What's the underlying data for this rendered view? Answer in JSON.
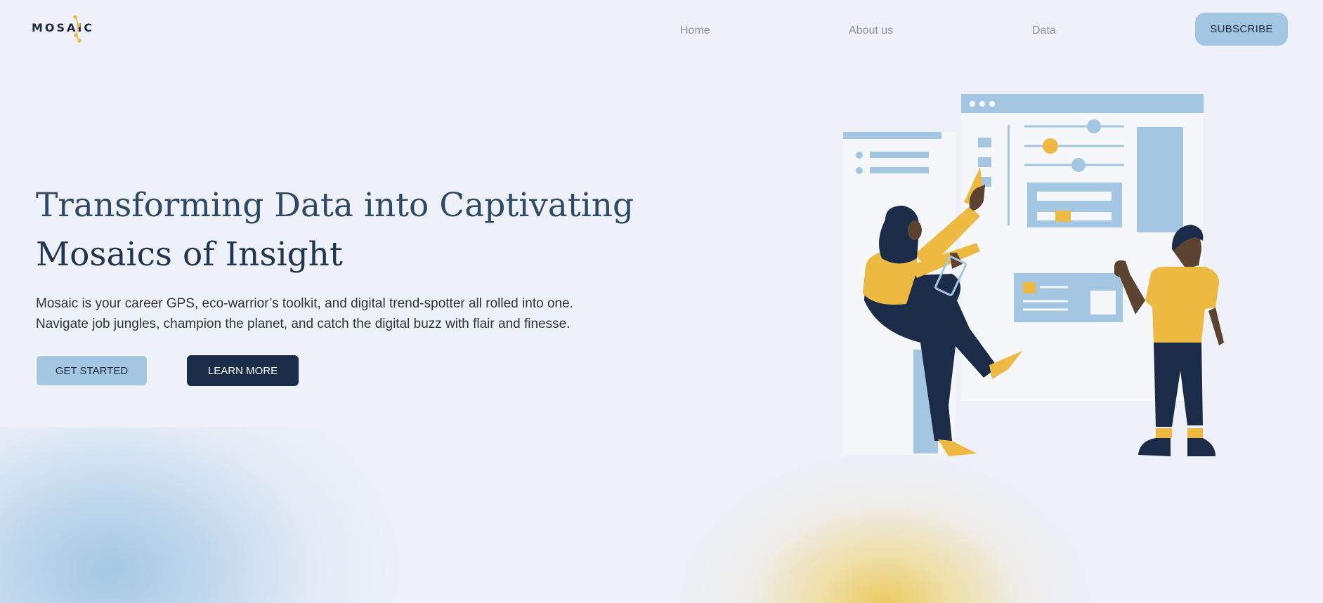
{
  "brand": {
    "logo_text": "MOSAIC"
  },
  "nav": {
    "items": [
      "Home",
      "About us",
      "Data"
    ],
    "subscribe_label": "SUBSCRIBE"
  },
  "hero": {
    "title_line1": "Transforming Data into Captivating",
    "title_line2": "Mosaics of Insight",
    "description_line1": "Mosaic is your career GPS, eco-warrior’s toolkit, and digital trend-spotter all rolled into one.",
    "description_line2": "Navigate job jungles, champion the planet, and catch the digital buzz with flair and finesse.",
    "primary_cta": "GET STARTED",
    "secondary_cta": "LEARN MORE"
  },
  "colors": {
    "background": "#eef1f9",
    "accent_blue": "#a3c7e2",
    "navy": "#1a2c48",
    "accent_yellow": "#edb941",
    "skin": "#5b4330"
  },
  "icons": [
    "logo-node-icon"
  ]
}
